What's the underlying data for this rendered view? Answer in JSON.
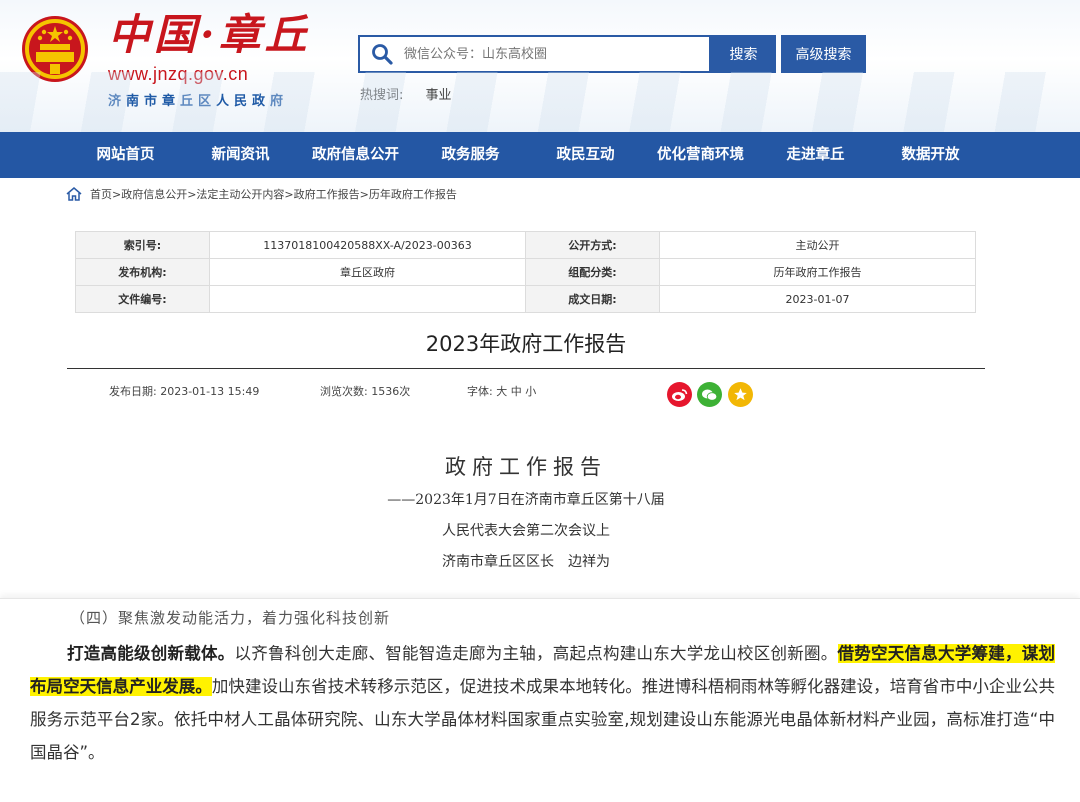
{
  "header": {
    "logo_cn": "中国·章丘",
    "logo_url": "www.jnzq.gov.cn",
    "logo_sub": "济南市章丘区人民政府",
    "search_placeholder": "微信公众号：山东高校圈",
    "search_button": "搜索",
    "advanced_button": "高级搜索",
    "hot_label": "热搜词:",
    "hot_item": "事业"
  },
  "nav": [
    "网站首页",
    "新闻资讯",
    "政府信息公开",
    "政务服务",
    "政民互动",
    "优化营商环境",
    "走进章丘",
    "数据开放"
  ],
  "breadcrumb": "首页>政府信息公开>法定主动公开内容>政府工作报告>历年政府工作报告",
  "meta": {
    "index_label": "索引号:",
    "index_value": "1137018100420588XX-A/2023-00363",
    "open_label": "公开方式:",
    "open_value": "主动公开",
    "org_label": "发布机构:",
    "org_value": "章丘区政府",
    "cat_label": "组配分类:",
    "cat_value": "历年政府工作报告",
    "docno_label": "文件编号:",
    "docno_value": "",
    "date_label": "成文日期:",
    "date_value": "2023-01-07"
  },
  "title": "2023年政府工作报告",
  "info": {
    "publish": "发布日期: 2023-01-13 15:49",
    "views": "浏览次数: 1536次",
    "font": "字体: 大 中 小"
  },
  "colors": {
    "weibo": "#e6162d",
    "wechat": "#3db135",
    "favorite": "#f2b705",
    "brand": "#2457a4"
  },
  "doc": {
    "heading": "政府工作报告",
    "line1": "——2023年1月7日在济南市章丘区第十八届",
    "line2": "人民代表大会第二次会议上",
    "line3": "济南市章丘区区长　边祥为"
  },
  "article": {
    "section": "（四）聚焦激发动能活力，着力强化科技创新",
    "lead": "打造高能级创新载体。",
    "text1": "以齐鲁科创大走廊、智能智造走廊为主轴，高起点构建山东大学龙山校区创新圈。",
    "highlight": "借势空天信息大学筹建，谋划布局空天信息产业发展。",
    "text2": "加快建设山东省技术转移示范区，促进技术成果本地转化。推进博科梧桐雨林等孵化器建设，培育省市中小企业公共服务示范平台2家。依托中材人工晶体研究院、山东大学晶体材料国家重点实验室,规划建设山东能源光电晶体新材料产业园，高标准打造“中国晶谷”。"
  }
}
